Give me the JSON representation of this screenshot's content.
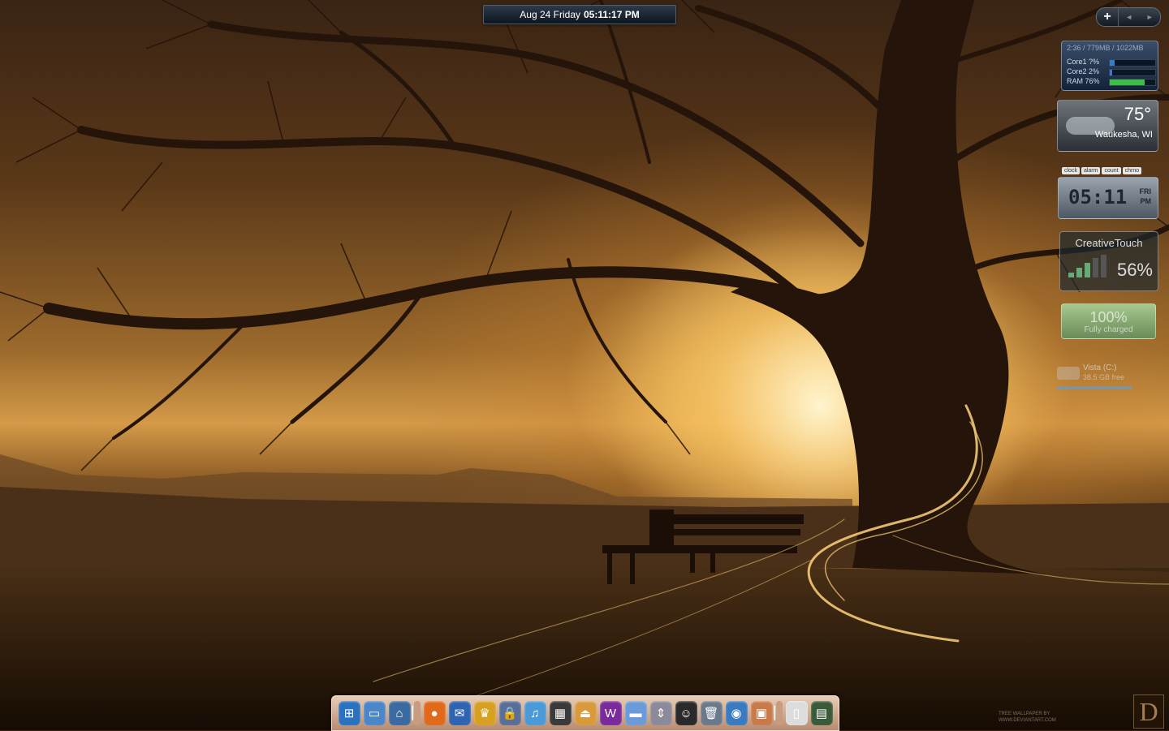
{
  "topbar": {
    "date": "Aug 24 Friday",
    "time": "05:11:17 PM"
  },
  "sidebar_controls": {
    "add": "+",
    "prev": "◄",
    "next": "►"
  },
  "cpu": {
    "header": "2:36 / 779MB / 1022MB",
    "rows": [
      {
        "label": "Core1",
        "value": "?%",
        "level": 0.1,
        "color": "#3a7ad0"
      },
      {
        "label": "Core2",
        "value": "2%",
        "level": 0.05,
        "color": "#3a7ad0"
      },
      {
        "label": "RAM",
        "value": "76%",
        "level": 0.76,
        "color": "#3cbf48"
      }
    ]
  },
  "weather": {
    "temp": "75°",
    "city": "Waukesha, WI"
  },
  "clock_tabs": [
    "clock",
    "alarm",
    "count",
    "chrno"
  ],
  "clock": {
    "time": "05:11",
    "day": "FRI",
    "ampm": "PM"
  },
  "touch": {
    "name": "CreativeTouch",
    "percent": "56%"
  },
  "battery": {
    "percent": "100%",
    "status": "Fully charged"
  },
  "drive": {
    "name": "Vista (C:)",
    "size": "38.5 GB free"
  },
  "dock": {
    "items": [
      {
        "name": "windows-start",
        "glyph": "⊞",
        "color": "#2a72c0"
      },
      {
        "name": "my-computer",
        "glyph": "▭",
        "color": "#4a86c8"
      },
      {
        "name": "network",
        "glyph": "⌂",
        "color": "#3a6aa0"
      },
      {
        "name": "separator",
        "glyph": "▏",
        "color": "#c89c7e"
      },
      {
        "name": "firefox",
        "glyph": "●",
        "color": "#e06a1a"
      },
      {
        "name": "thunderbird",
        "glyph": "✉",
        "color": "#2e64b0"
      },
      {
        "name": "crown",
        "glyph": "♛",
        "color": "#d8a020"
      },
      {
        "name": "lock",
        "glyph": "🔒",
        "color": "#5a6e9a"
      },
      {
        "name": "itunes",
        "glyph": "♫",
        "color": "#4a9ad8"
      },
      {
        "name": "puzzle",
        "glyph": "▦",
        "color": "#3a3a3a"
      },
      {
        "name": "eject",
        "glyph": "⏏",
        "color": "#d89a3a"
      },
      {
        "name": "word",
        "glyph": "W",
        "color": "#7a2a9a"
      },
      {
        "name": "folder",
        "glyph": "▬",
        "color": "#6a9ad8"
      },
      {
        "name": "arrows",
        "glyph": "⇕",
        "color": "#8a8a9a"
      },
      {
        "name": "user",
        "glyph": "☺",
        "color": "#2a2a2a"
      },
      {
        "name": "recycle-bin",
        "glyph": "🗑",
        "color": "#6a7a8a"
      },
      {
        "name": "globe",
        "glyph": "◉",
        "color": "#3a7ac0"
      },
      {
        "name": "package",
        "glyph": "▣",
        "color": "#c87a4a"
      },
      {
        "name": "separator2",
        "glyph": "▏",
        "color": "#c89c7e"
      },
      {
        "name": "remote",
        "glyph": "▯",
        "color": "#dcdcdc"
      },
      {
        "name": "photo",
        "glyph": "▤",
        "color": "#3a5a3a"
      }
    ]
  },
  "logo": "D",
  "credit": [
    "TREE WALLPAPER BY",
    "WWW.DEVIANTART.COM"
  ]
}
